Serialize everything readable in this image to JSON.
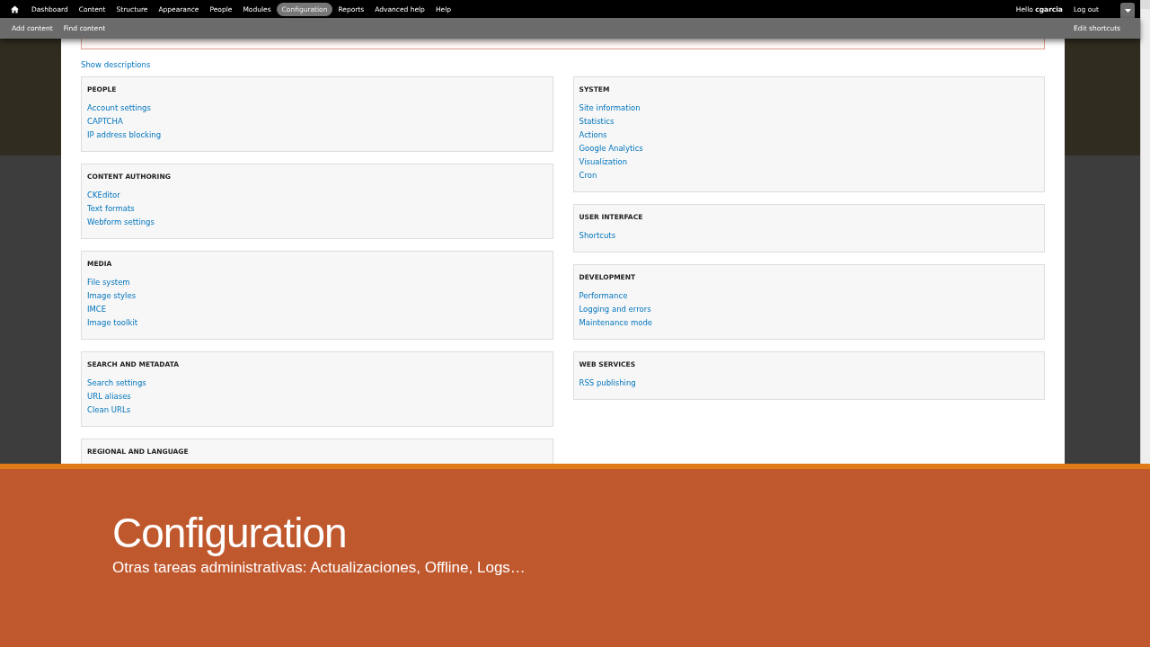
{
  "toolbar": {
    "menu": [
      {
        "label": "Dashboard",
        "selected": false
      },
      {
        "label": "Content",
        "selected": false
      },
      {
        "label": "Structure",
        "selected": false
      },
      {
        "label": "Appearance",
        "selected": false
      },
      {
        "label": "People",
        "selected": false
      },
      {
        "label": "Modules",
        "selected": false
      },
      {
        "label": "Configuration",
        "selected": true
      },
      {
        "label": "Reports",
        "selected": false
      },
      {
        "label": "Advanced help",
        "selected": false
      },
      {
        "label": "Help",
        "selected": false
      }
    ],
    "greeting": "Hello **cgarcia**",
    "logout": "Log out"
  },
  "shortcuts": {
    "items": [
      "Add content",
      "Find content"
    ],
    "edit": "Edit shortcuts"
  },
  "show_descriptions": "Show descriptions",
  "columns": [
    [
      {
        "title": "PEOPLE",
        "links": [
          "Account settings",
          "CAPTCHA",
          "IP address blocking"
        ]
      },
      {
        "title": "CONTENT AUTHORING",
        "links": [
          "CKEditor",
          "Text formats",
          "Webform settings"
        ]
      },
      {
        "title": "MEDIA",
        "links": [
          "File system",
          "Image styles",
          "IMCE",
          "Image toolkit"
        ]
      },
      {
        "title": "SEARCH AND METADATA",
        "links": [
          "Search settings",
          "URL aliases",
          "Clean URLs"
        ]
      },
      {
        "title": "REGIONAL AND LANGUAGE"
      }
    ],
    [
      {
        "title": "SYSTEM",
        "links": [
          "Site information",
          "Statistics",
          "Actions",
          "Google Analytics",
          "Visualization",
          "Cron"
        ]
      },
      {
        "title": "USER INTERFACE",
        "links": [
          "Shortcuts"
        ]
      },
      {
        "title": "DEVELOPMENT",
        "links": [
          "Performance",
          "Logging and errors",
          "Maintenance mode"
        ]
      },
      {
        "title": "WEB SERVICES",
        "links": [
          "RSS publishing"
        ]
      }
    ]
  ],
  "slide": {
    "title": "Configuration",
    "subtitle": "Otras tareas administrativas: Actualizaciones, Offline, Logs…"
  }
}
